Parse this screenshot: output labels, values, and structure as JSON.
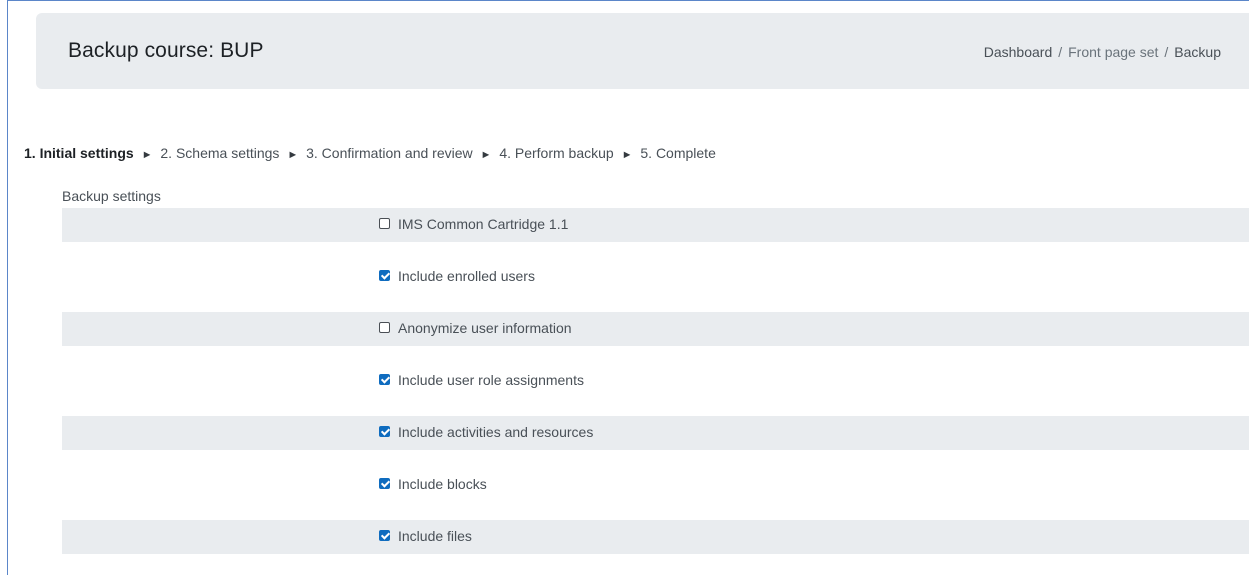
{
  "header": {
    "title": "Backup course: BUP",
    "breadcrumb": [
      "Dashboard",
      "Front page set",
      "Backup"
    ],
    "separator": "/"
  },
  "progress": {
    "steps": [
      "1. Initial settings",
      "2. Schema settings",
      "3. Confirmation and review",
      "4. Perform backup",
      "5. Complete"
    ],
    "arrow": "►"
  },
  "section": {
    "legend": "Backup settings",
    "settings": [
      {
        "label": "IMS Common Cartridge 1.1",
        "checked": false
      },
      {
        "label": "Include enrolled users",
        "checked": true
      },
      {
        "label": "Anonymize user information",
        "checked": false
      },
      {
        "label": "Include user role assignments",
        "checked": true
      },
      {
        "label": "Include activities and resources",
        "checked": true
      },
      {
        "label": "Include blocks",
        "checked": true
      },
      {
        "label": "Include files",
        "checked": true
      }
    ]
  }
}
